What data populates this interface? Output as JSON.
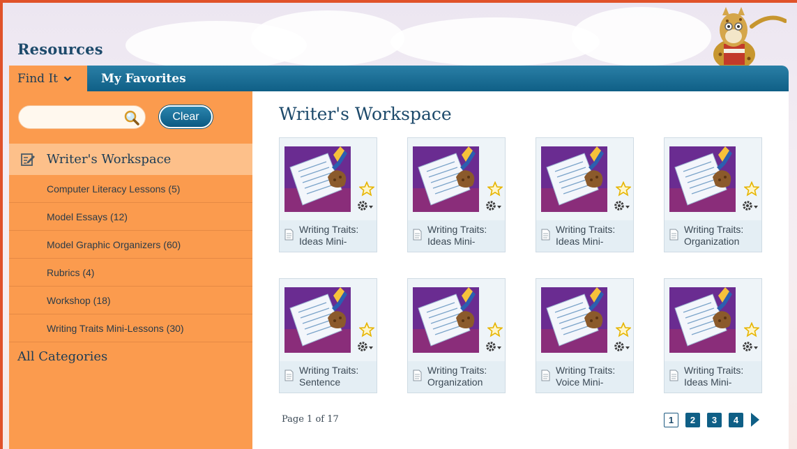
{
  "header": {
    "title": "Resources"
  },
  "nav": {
    "find_label": "Find It",
    "favorites_label": "My Favorites"
  },
  "search": {
    "value": "",
    "placeholder": "",
    "clear_label": "Clear"
  },
  "sidebar": {
    "active_category": "Writer's Workspace",
    "subcategories": [
      {
        "label": "Computer Literacy Lessons (5)"
      },
      {
        "label": "Model Essays (12)"
      },
      {
        "label": "Model Graphic Organizers (60)"
      },
      {
        "label": "Rubrics (4)"
      },
      {
        "label": "Workshop (18)"
      },
      {
        "label": "Writing Traits Mini-Lessons (30)"
      }
    ],
    "all_categories_label": "All Categories"
  },
  "main": {
    "title": "Writer's Workspace",
    "cards": [
      {
        "line1": "Writing Traits:",
        "line2": "Ideas Mini-"
      },
      {
        "line1": "Writing Traits:",
        "line2": "Ideas Mini-"
      },
      {
        "line1": "Writing Traits:",
        "line2": "Ideas Mini-"
      },
      {
        "line1": "Writing Traits:",
        "line2": "Organization"
      },
      {
        "line1": "Writing Traits:",
        "line2": "Sentence"
      },
      {
        "line1": "Writing Traits:",
        "line2": "Organization"
      },
      {
        "line1": "Writing Traits:",
        "line2": "Voice Mini-"
      },
      {
        "line1": "Writing Traits:",
        "line2": "Ideas Mini-"
      }
    ],
    "page_info": "Page 1 of 17",
    "pages": [
      "1",
      "2",
      "3",
      "4"
    ],
    "current_page": "1"
  },
  "colors": {
    "accent_orange": "#fb9b4e",
    "nav_blue": "#0f5f86",
    "title_navy": "#1d4a6b",
    "frame_red": "#e0522a",
    "thumb_purple": "#6a2c91"
  }
}
